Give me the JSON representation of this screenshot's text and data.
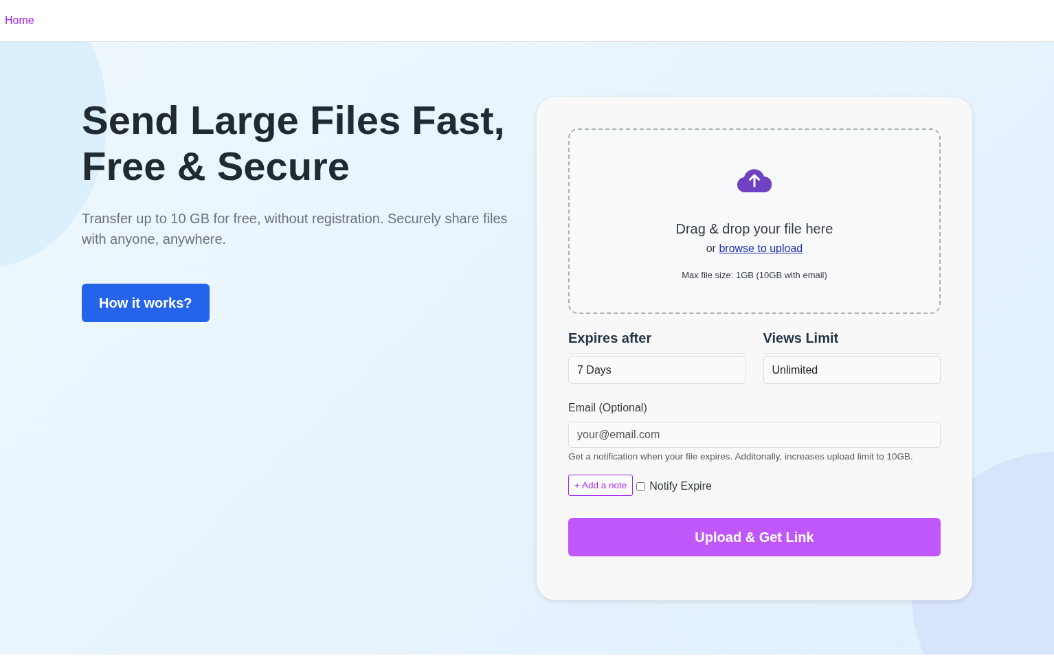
{
  "nav": {
    "link": "Home"
  },
  "hero": {
    "title_lines": [
      "Send Large Files Fast,",
      "Free & Secure"
    ],
    "subtitle": "Transfer up to 10 GB for free, without registration. Securely share files with anyone, anywhere.",
    "button": "How it works?"
  },
  "upload": {
    "dropzone": {
      "heading": "Drag & drop your file here",
      "prefix": "or",
      "link": "browse to upload",
      "limit": "Max file size: 1GB (10GB with email)"
    },
    "selects": [
      {
        "label": "Expires after",
        "value": "7 Days"
      },
      {
        "label": "Views Limit",
        "value": "Unlimited"
      }
    ],
    "email": {
      "label": "Email (Optional)",
      "placeholder": "your@email.com",
      "hint": "Get a notification when your file expires. Additonally, increases upload limit to 10GB."
    },
    "note_button": "+ Add a note",
    "notify": {
      "label": "Notify Expire",
      "checked": false
    },
    "submit": "Upload & Get Link"
  }
}
